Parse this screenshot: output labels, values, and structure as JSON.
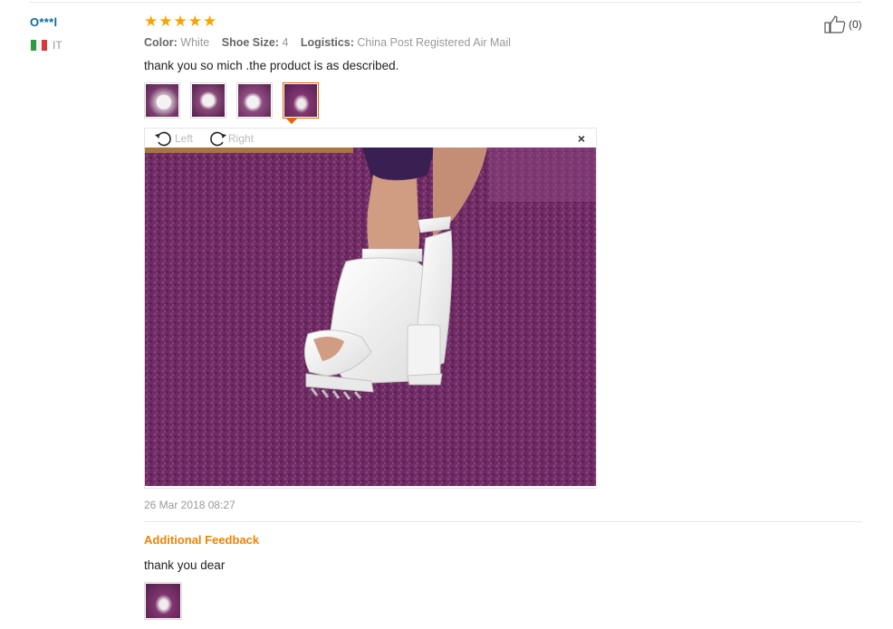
{
  "review": {
    "user": "O***l",
    "country": "IT",
    "rating": 5,
    "stars": [
      "★",
      "★",
      "★",
      "★",
      "★"
    ],
    "color_label": "Color:",
    "color_value": "White",
    "size_label": "Shoe Size:",
    "size_value": "4",
    "logistics_label": "Logistics:",
    "logistics_value": "China Post Registered Air Mail",
    "text": "thank you so mich .the product is as described.",
    "helpful_count": "(0)",
    "thumbnails": [
      "photo-1",
      "photo-2",
      "photo-3",
      "photo-4"
    ],
    "selected_thumbnail": 4,
    "date": "26 Mar 2018 08:27"
  },
  "viewer": {
    "rotate_left": "Left",
    "rotate_right": "Right",
    "close": "×"
  },
  "additional": {
    "title": "Additional Feedback",
    "text": "thank you dear",
    "thumbnails": [
      "photo-1"
    ]
  },
  "colors": {
    "user_link": "#0a6aa1",
    "star": "#f7a300",
    "accent": "#e56600",
    "additional_title": "#f08200"
  }
}
